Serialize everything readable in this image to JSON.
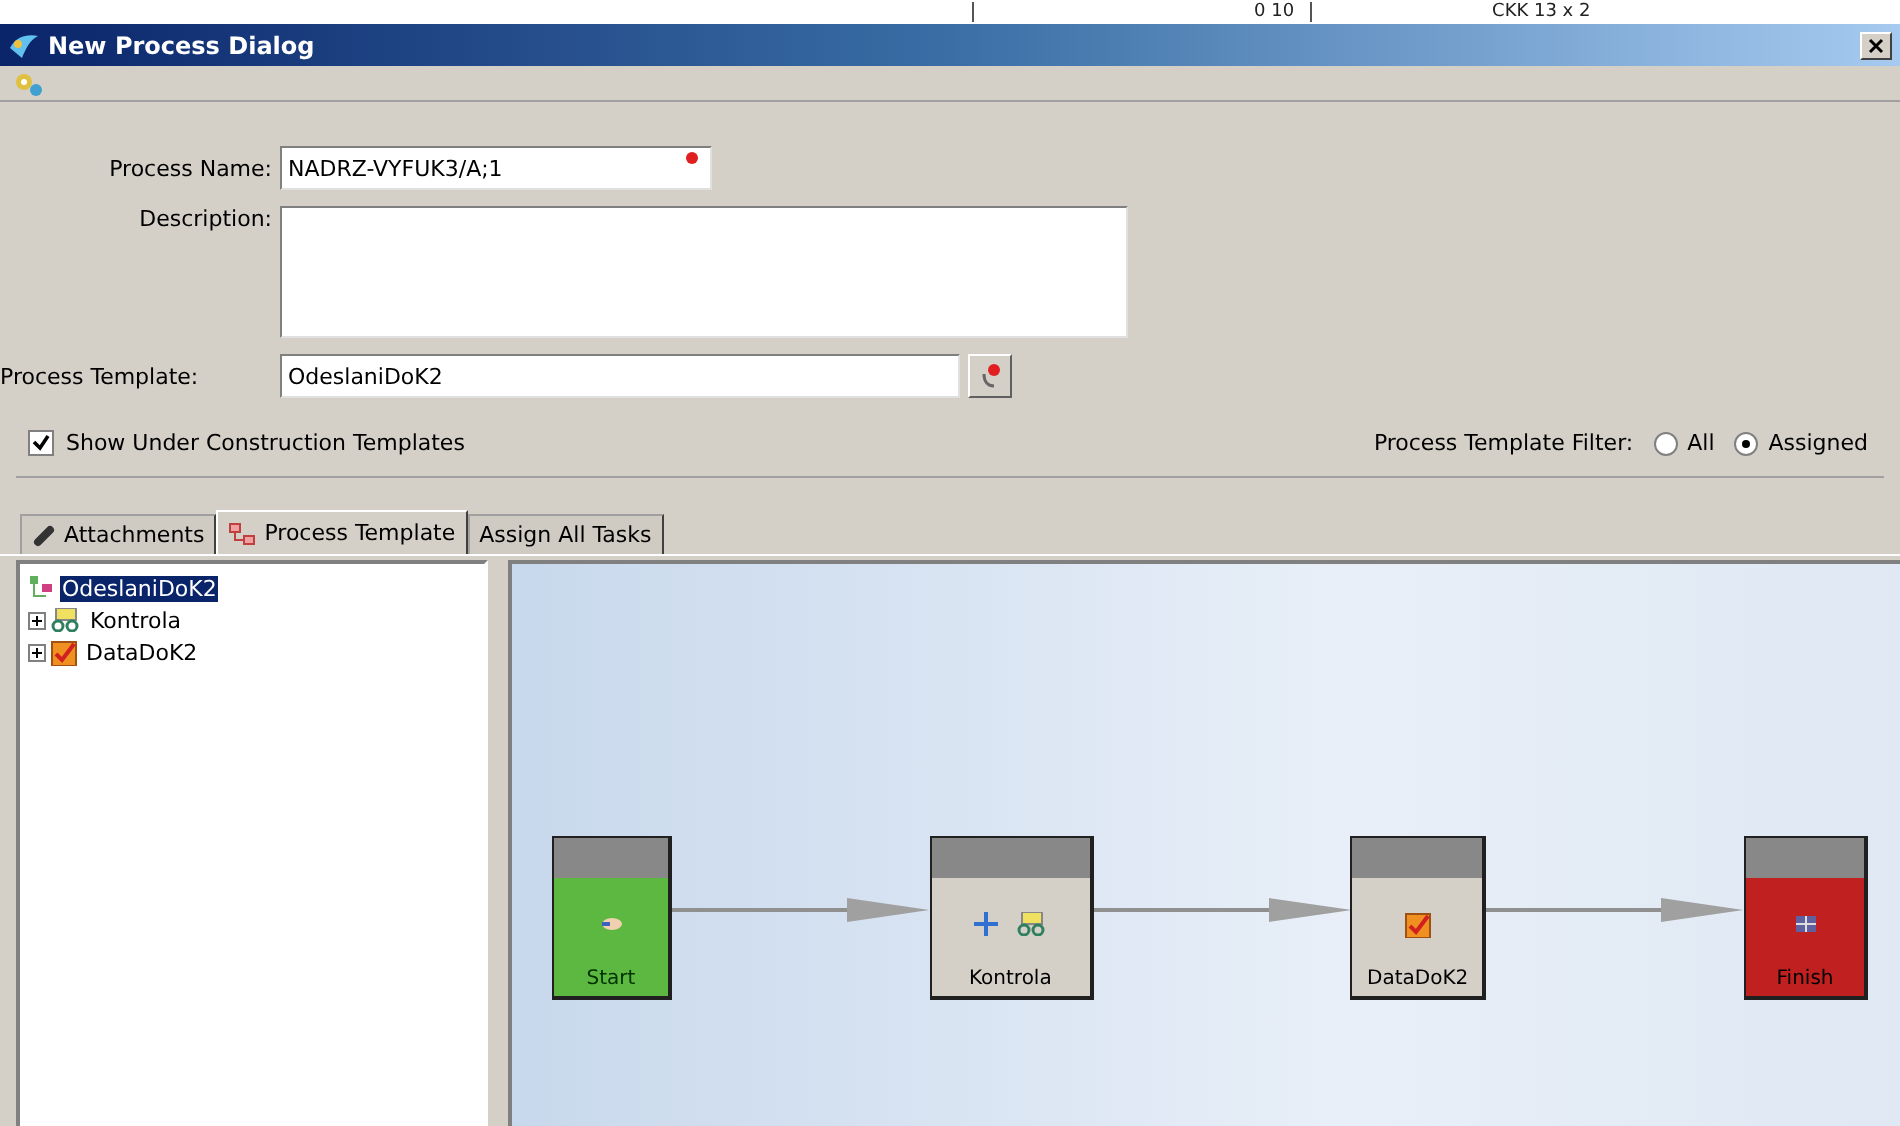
{
  "background_window": {
    "cells": [
      "0 10",
      "CKK 13 x 2"
    ]
  },
  "window": {
    "title": "New Process Dialog"
  },
  "form": {
    "process_name": {
      "label": "Process Name:",
      "value": "NADRZ-VYFUK3/A;1",
      "required": true
    },
    "description": {
      "label": "Description:"
    },
    "process_template": {
      "label": "Process Template:",
      "value": "OdeslaniDoK2",
      "required": true
    },
    "show_under_construction": {
      "label": "Show Under Construction Templates",
      "checked": true
    },
    "filter": {
      "label": "Process Template Filter:",
      "options": [
        {
          "label": "All",
          "selected": false
        },
        {
          "label": "Assigned",
          "selected": true
        }
      ]
    }
  },
  "tabs": [
    {
      "label": "Attachments",
      "kind": "attachments",
      "selected": false
    },
    {
      "label": "Process Template",
      "kind": "template",
      "selected": true
    },
    {
      "label": "Assign All Tasks",
      "kind": "plain",
      "selected": false
    }
  ],
  "tree": {
    "root": {
      "label": "OdeslaniDoK2",
      "selected": true,
      "children": [
        {
          "label": "Kontrola",
          "kind": "review",
          "expanded": false
        },
        {
          "label": "DataDoK2",
          "kind": "form",
          "expanded": false
        }
      ]
    }
  },
  "diagram": {
    "nodes": [
      {
        "label": "Start",
        "kind": "start"
      },
      {
        "label": "Kontrola",
        "kind": "review"
      },
      {
        "label": "DataDoK2",
        "kind": "form"
      },
      {
        "label": "Finish",
        "kind": "finish"
      }
    ]
  }
}
